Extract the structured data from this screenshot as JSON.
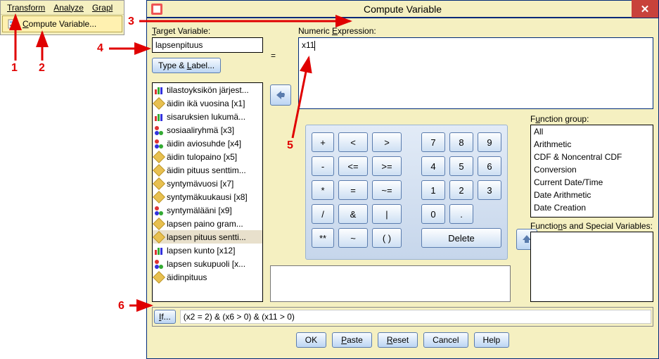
{
  "menu": {
    "items": [
      "Transform",
      "Analyze",
      "Grapl"
    ],
    "submenu_label": "Compute Variable..."
  },
  "dialog": {
    "title": "Compute Variable",
    "target_label": "Target Variable:",
    "target_value": "lapsenpituus",
    "type_label_btn": "Type & Label...",
    "equals": "=",
    "numexp_label": "Numeric Expression:",
    "numexp_value": "x11",
    "func_group_label": "Function group:",
    "func_special_label": "Functions and Special Variables:",
    "if_btn": "If...",
    "if_condition": "(x2 = 2) & (x6 > 0) & (x11 > 0)",
    "buttons": {
      "ok": "OK",
      "paste": "Paste",
      "reset": "Reset",
      "cancel": "Cancel",
      "help": "Help"
    }
  },
  "variables": [
    {
      "icon": "bars",
      "label": "tilastoyksikön järjest..."
    },
    {
      "icon": "ruler",
      "label": "äidin ikä vuosina [x1]"
    },
    {
      "icon": "bars",
      "label": "sisaruksien lukumä..."
    },
    {
      "icon": "balls",
      "label": "sosiaaliryhmä [x3]"
    },
    {
      "icon": "balls",
      "label": "äidin aviosuhde [x4]"
    },
    {
      "icon": "ruler",
      "label": "äidin tulopaino [x5]"
    },
    {
      "icon": "ruler",
      "label": "äidin pituus senttim..."
    },
    {
      "icon": "ruler",
      "label": "syntymävuosi [x7]"
    },
    {
      "icon": "ruler",
      "label": "syntymäkuukausi [x8]"
    },
    {
      "icon": "balls",
      "label": "syntymälääni [x9]"
    },
    {
      "icon": "ruler",
      "label": "lapsen paino gram..."
    },
    {
      "icon": "ruler",
      "label": "lapsen pituus sentti...",
      "selected": true
    },
    {
      "icon": "bars",
      "label": "lapsen kunto [x12]"
    },
    {
      "icon": "balls",
      "label": "lapsen sukupuoli [x..."
    },
    {
      "icon": "ruler",
      "label": "äidinpituus"
    }
  ],
  "calc": {
    "r0": [
      "+",
      "<",
      ">",
      "7",
      "8",
      "9"
    ],
    "r1": [
      "-",
      "<=",
      ">=",
      "4",
      "5",
      "6"
    ],
    "r2": [
      "*",
      "=",
      "~=",
      "1",
      "2",
      "3"
    ],
    "r3": [
      "/",
      "&",
      "|",
      "0",
      "."
    ],
    "r4": [
      "**",
      "~",
      "( )",
      "Delete"
    ]
  },
  "func_groups": [
    "All",
    "Arithmetic",
    "CDF & Noncentral CDF",
    "Conversion",
    "Current Date/Time",
    "Date Arithmetic",
    "Date Creation"
  ],
  "annotations": [
    "1",
    "2",
    "3",
    "4",
    "5",
    "6"
  ]
}
